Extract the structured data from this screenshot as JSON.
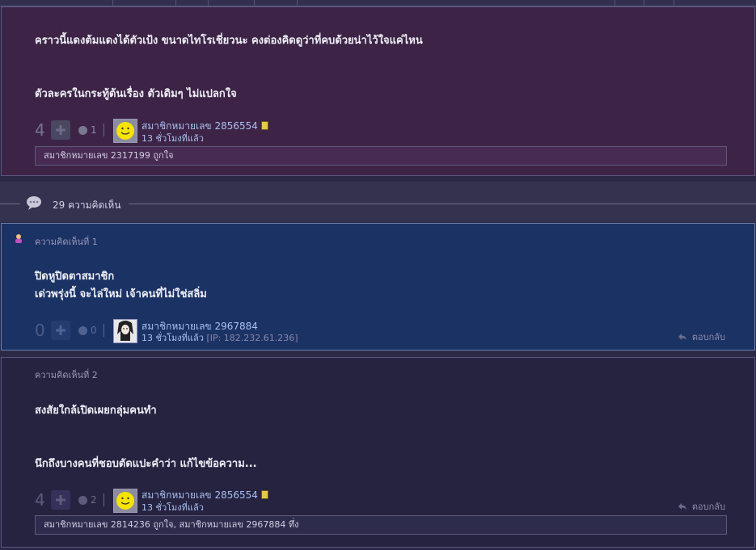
{
  "top_post": {
    "lines": [
      "คราวนี้แดงต้มแดงได้ตัวเป้ง ขนาดไทโรเชี่ยวนะ คงต่องคิดดูว่าที่คบด้วยน่าไว้ใจแค่ไหน",
      "ตัวละครในกระทู้ต้นเรื่อง ตัวเดิมๆ ไม่แปลกใจ"
    ],
    "votes": "4",
    "emotions": "1",
    "member": "สมาชิกหมายเลข 2856554",
    "time": "13 ชั่วโมงที่แล้ว",
    "likes": "สมาชิกหมายเลข 2317199 ถูกใจ"
  },
  "comment_count": "29 ความคิดเห็น",
  "comments": [
    {
      "label": "ความคิดเห็นที่ 1",
      "lines": [
        "ปิดหูปิดตาสมาชิก",
        "เด่วพรุ่งนี้ จะไล่ใหม่ เจ้าคนที่ไม่ใช่สลิ่ม"
      ],
      "votes": "0",
      "emotions": "0",
      "member": "สมาชิกหมายเลข 2967884",
      "time": "13 ชั่วโมงที่แล้ว",
      "ip": "[IP: 182.232.61.236]",
      "reply": "ตอบกลับ"
    },
    {
      "label": "ความคิดเห็นที่ 2",
      "lines": [
        "สงสัยใกล้เปิดเผยกลุ่มคนทำ",
        "นึกถึงบางคนที่ชอบตัดแปะคำว่า แก้ไขข้อความ..."
      ],
      "votes": "4",
      "emotions": "2",
      "member": "สมาชิกหมายเลข 2856554",
      "time": "13 ชั่วโมงที่แล้ว",
      "reply": "ตอบกลับ",
      "likes": "สมาชิกหมายเลข 2814236 ถูกใจ, สมาชิกหมายเลข 2967884 ทึ่ง"
    }
  ],
  "icons": {
    "plus": "plus-icon",
    "emotion": "emotion-face-icon",
    "reply": "reply-arrow-icon",
    "comments": "comment-bubble-icon",
    "owner": "owner-badge-icon",
    "avatar_smiley": "smiley-avatar",
    "avatar_anime": "anime-avatar"
  },
  "colors": {
    "page_bg": "#2b2945",
    "top_post_bg": "#3d2446",
    "comment1_bg": "#1b3264",
    "comment2_bg": "#252340",
    "link": "#aac0f0"
  }
}
